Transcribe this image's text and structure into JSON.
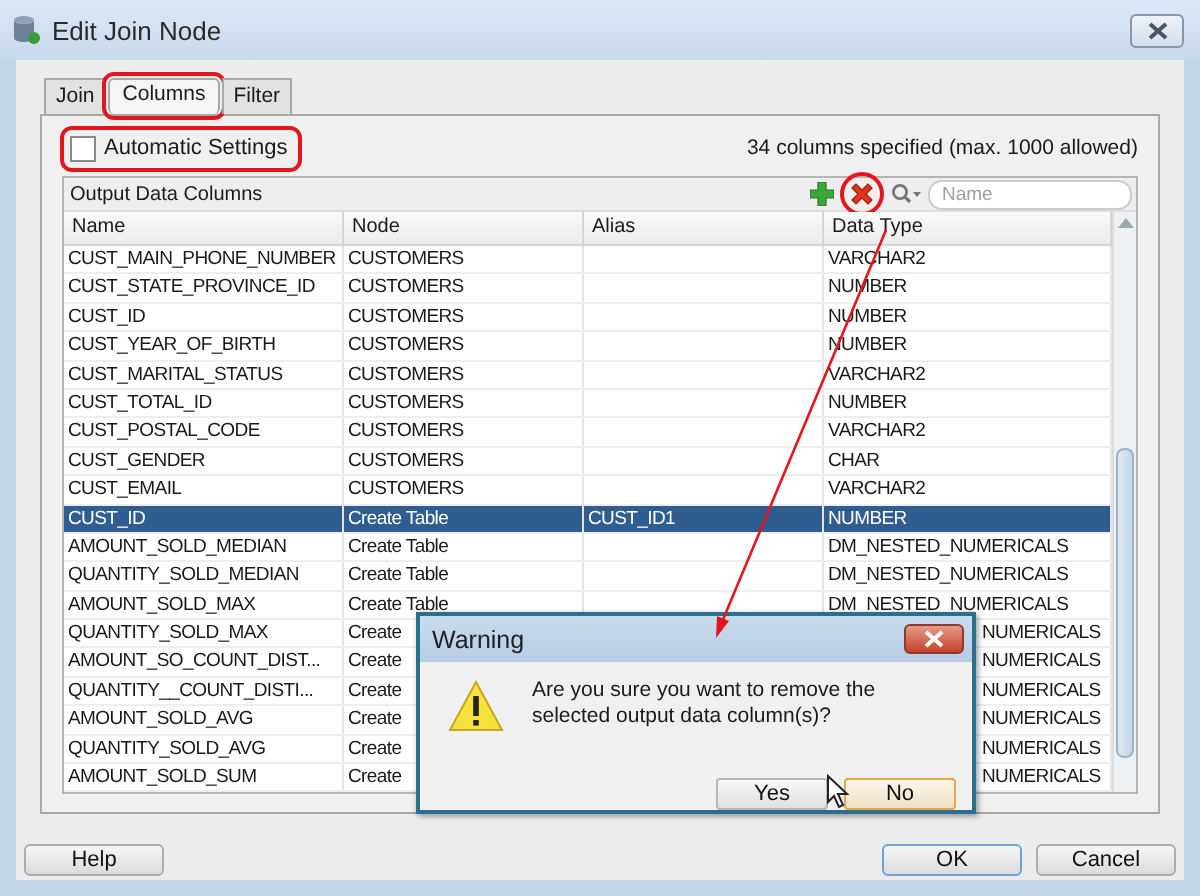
{
  "window": {
    "title": "Edit Join Node"
  },
  "tabs": [
    {
      "label": "Join",
      "selected": false,
      "highlighted": false
    },
    {
      "label": "Columns",
      "selected": true,
      "highlighted": true
    },
    {
      "label": "Filter",
      "selected": false,
      "highlighted": false
    }
  ],
  "automatic_settings": {
    "label": "Automatic Settings",
    "checked": false,
    "highlighted": true
  },
  "column_count": "34 columns specified (max. 1000 allowed)",
  "output_columns": {
    "title": "Output Data Columns",
    "toolbar": [
      {
        "kind": "add",
        "highlighted": false
      },
      {
        "kind": "delete",
        "highlighted": true
      }
    ],
    "search": {
      "placeholder": "Name"
    },
    "columns": [
      "Name",
      "Node",
      "Alias",
      "Data Type"
    ],
    "rows": [
      {
        "name": "CUST_MAIN_PHONE_NUMBER",
        "node": "CUSTOMERS",
        "data_type": "VARCHAR2",
        "selected": false,
        "covered": false
      },
      {
        "name": "CUST_STATE_PROVINCE_ID",
        "node": "CUSTOMERS",
        "data_type": "NUMBER",
        "selected": false,
        "covered": false
      },
      {
        "name": "CUST_ID",
        "node": "CUSTOMERS",
        "data_type": "NUMBER",
        "selected": false,
        "covered": false
      },
      {
        "name": "CUST_YEAR_OF_BIRTH",
        "node": "CUSTOMERS",
        "data_type": "NUMBER",
        "selected": false,
        "covered": false
      },
      {
        "name": "CUST_MARITAL_STATUS",
        "node": "CUSTOMERS",
        "data_type": "VARCHAR2",
        "selected": false,
        "covered": false
      },
      {
        "name": "CUST_TOTAL_ID",
        "node": "CUSTOMERS",
        "data_type": "NUMBER",
        "selected": false,
        "covered": false
      },
      {
        "name": "CUST_POSTAL_CODE",
        "node": "CUSTOMERS",
        "data_type": "VARCHAR2",
        "selected": false,
        "covered": false
      },
      {
        "name": "CUST_GENDER",
        "node": "CUSTOMERS",
        "data_type": "CHAR",
        "selected": false,
        "covered": false
      },
      {
        "name": "CUST_EMAIL",
        "node": "CUSTOMERS",
        "data_type": "VARCHAR2",
        "selected": false,
        "covered": false
      },
      {
        "name": "CUST_ID",
        "node": "Create Table",
        "alias": "CUST_ID1",
        "data_type": "NUMBER",
        "selected": true,
        "covered": false
      },
      {
        "name": "AMOUNT_SOLD_MEDIAN",
        "node": "Create Table",
        "data_type": "DM_NESTED_NUMERICALS",
        "selected": false,
        "covered": false
      },
      {
        "name": "QUANTITY_SOLD_MEDIAN",
        "node": "Create Table",
        "data_type": "DM_NESTED_NUMERICALS",
        "selected": false,
        "covered": false
      },
      {
        "name": "AMOUNT_SOLD_MAX",
        "node": "Create Table",
        "data_type": "DM_NESTED_NUMERICALS",
        "selected": false,
        "covered": false
      },
      {
        "name": "QUANTITY_SOLD_MAX",
        "node": "Create",
        "data_type": "NUMERICALS",
        "selected": false,
        "covered": true
      },
      {
        "name": "AMOUNT_SO_COUNT_DIST...",
        "node": "Create",
        "data_type": "NUMERICALS",
        "selected": false,
        "covered": true
      },
      {
        "name": "QUANTITY__COUNT_DISTI...",
        "node": "Create",
        "data_type": "NUMERICALS",
        "selected": false,
        "covered": true
      },
      {
        "name": "AMOUNT_SOLD_AVG",
        "node": "Create",
        "data_type": "NUMERICALS",
        "selected": false,
        "covered": true
      },
      {
        "name": "QUANTITY_SOLD_AVG",
        "node": "Create",
        "data_type": "NUMERICALS",
        "selected": false,
        "covered": true
      },
      {
        "name": "AMOUNT_SOLD_SUM",
        "node": "Create",
        "data_type": "NUMERICALS",
        "selected": false,
        "covered": true
      }
    ]
  },
  "warning_dialog": {
    "title": "Warning",
    "message": "Are you sure you want to remove the selected output data column(s)?",
    "buttons": [
      {
        "label": "Yes",
        "default": false
      },
      {
        "label": "No",
        "default": true
      }
    ]
  },
  "buttons": [
    {
      "label": "Help",
      "default": false
    },
    {
      "label": "OK",
      "default": true
    },
    {
      "label": "Cancel",
      "default": false
    }
  ]
}
